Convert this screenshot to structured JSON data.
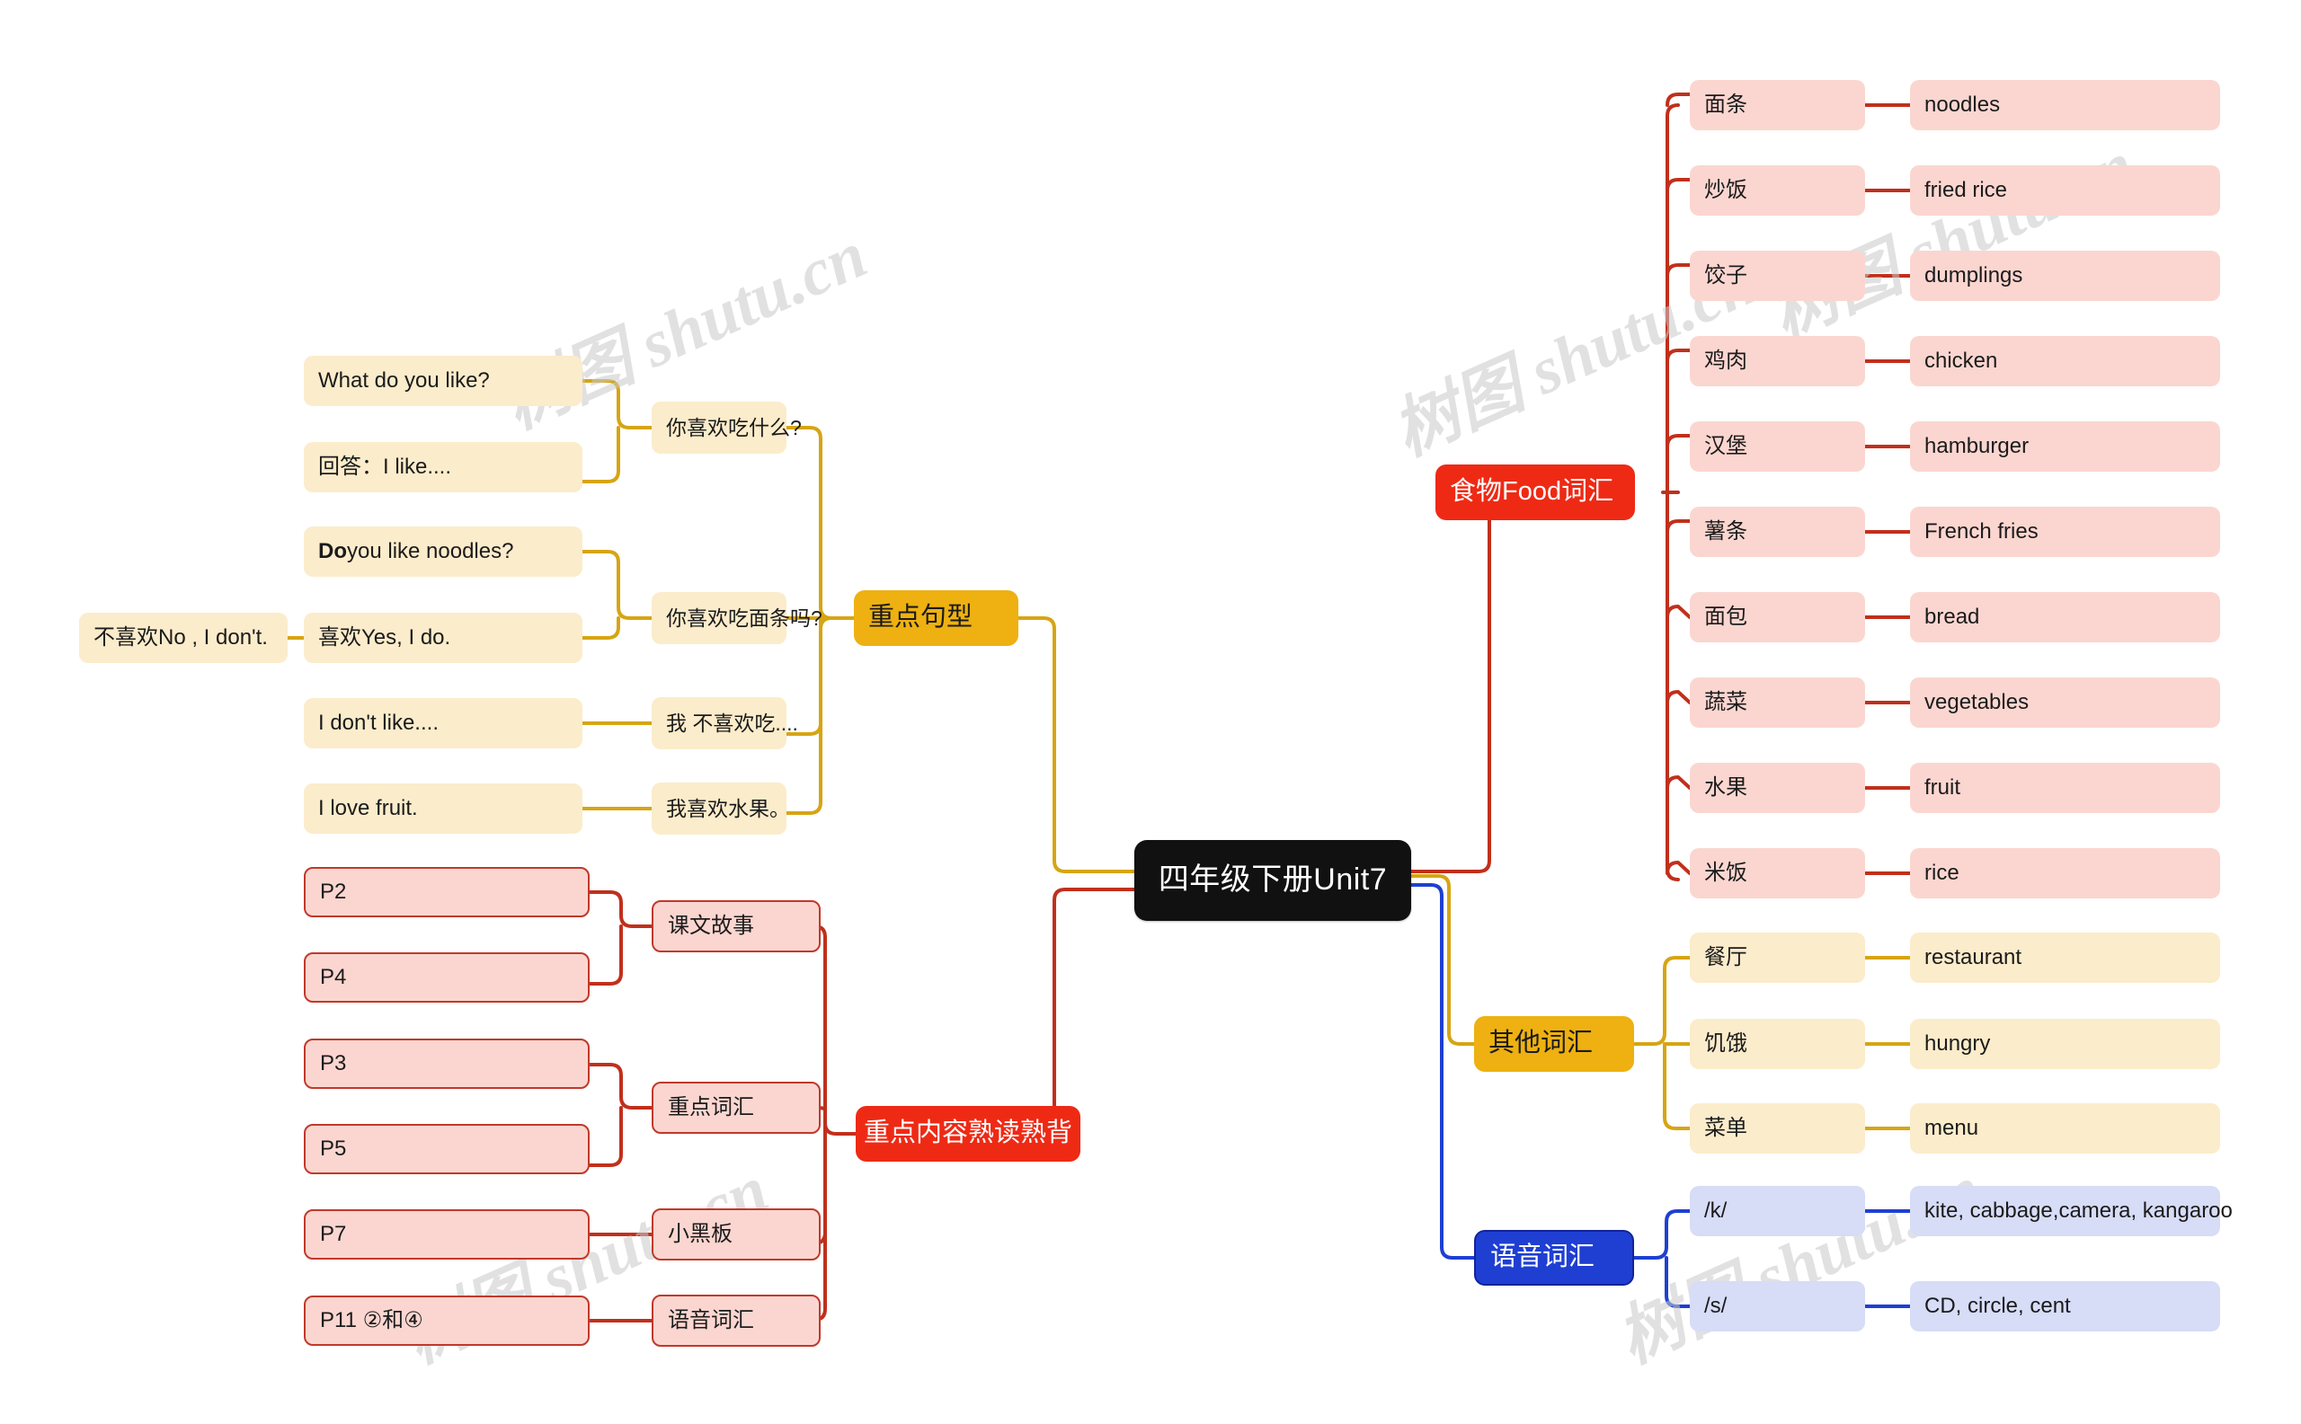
{
  "root": {
    "label": "四年级下册Unit7"
  },
  "watermarks": [
    {
      "text": "树图 shutu.cn"
    },
    {
      "text": "树图 shutu.cn"
    },
    {
      "text": "树图 shutu.cn"
    },
    {
      "text": "树图 shutu.cn"
    },
    {
      "text": "树图 shutu.cn"
    }
  ],
  "colors": {
    "root_bg": "#111111",
    "gold": "#eeb111",
    "red": "#ee2a15",
    "blue": "#1f3fd2",
    "cream": "#fbeccb",
    "pink": "#fbd6d0",
    "lavender": "#d7dcf7",
    "gold_line": "#d6a513",
    "red_line": "#c0301c",
    "blue_line": "#1f3fd2"
  },
  "branches": {
    "sentences": {
      "label": "重点句型",
      "items": [
        {
          "cn": "你喜欢吃什么?",
          "en": [
            "What do you like?",
            "回答：I like...."
          ]
        },
        {
          "cn": "你喜欢吃面条吗?",
          "en": [
            "Do you like noodles?",
            "喜欢Yes, I do."
          ],
          "bold_prefix": "Do",
          "tail": "不喜欢No , I don't."
        },
        {
          "cn": "我 不喜欢吃....",
          "en": [
            "I don't like...."
          ]
        },
        {
          "cn": "我喜欢水果。",
          "en": [
            "I love fruit."
          ]
        }
      ]
    },
    "recite": {
      "label": "重点内容熟读熟背",
      "groups": [
        {
          "label": "课文故事",
          "pages": [
            "P2",
            "P4"
          ]
        },
        {
          "label": "重点词汇",
          "pages": [
            "P3",
            "P5"
          ]
        },
        {
          "label": "小黑板",
          "pages": [
            "P7"
          ]
        },
        {
          "label": "语音词汇",
          "pages": [
            "P11 ②和④"
          ]
        }
      ]
    },
    "food": {
      "label": "食物Food词汇",
      "pairs": [
        {
          "cn": "面条",
          "en": "noodles"
        },
        {
          "cn": "炒饭",
          "en": "fried rice"
        },
        {
          "cn": "饺子",
          "en": "dumplings"
        },
        {
          "cn": "鸡肉",
          "en": "chicken"
        },
        {
          "cn": "汉堡",
          "en": "hamburger"
        },
        {
          "cn": "薯条",
          "en": "French fries"
        },
        {
          "cn": "面包",
          "en": "bread"
        },
        {
          "cn": "蔬菜",
          "en": "vegetables"
        },
        {
          "cn": "水果",
          "en": "fruit"
        },
        {
          "cn": "米饭",
          "en": "rice"
        }
      ]
    },
    "other": {
      "label": "其他词汇",
      "pairs": [
        {
          "cn": "餐厅",
          "en": "restaurant"
        },
        {
          "cn": "饥饿",
          "en": "hungry"
        },
        {
          "cn": "菜单",
          "en": "menu"
        }
      ]
    },
    "phonics": {
      "label": "语音词汇",
      "pairs": [
        {
          "cn": "/k/",
          "en": "kite, cabbage,camera, kangaroo"
        },
        {
          "cn": "/s/",
          "en": "CD, circle, cent"
        }
      ]
    }
  }
}
